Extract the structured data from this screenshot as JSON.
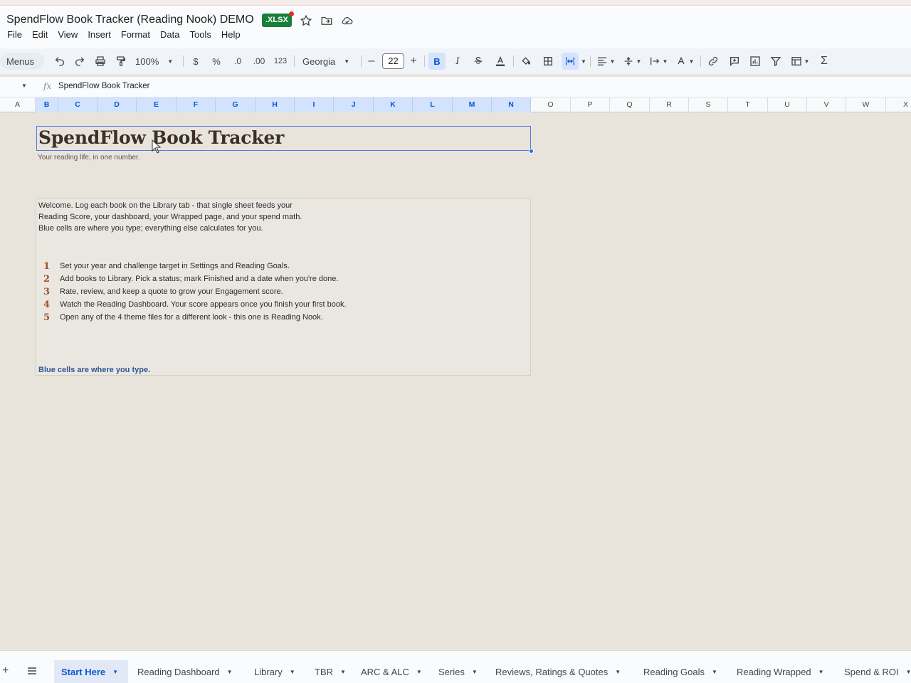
{
  "header": {
    "doc_title": "SpendFlow Book Tracker (Reading Nook) DEMO",
    "badge": ".XLSX",
    "menu": [
      "File",
      "Edit",
      "View",
      "Insert",
      "Format",
      "Data",
      "Tools",
      "Help"
    ]
  },
  "toolbar": {
    "menus_label": "Menus",
    "zoom": "100%",
    "currency": "$",
    "percent": "%",
    "dec_decrease": ".0",
    "dec_increase": ".00",
    "number_format": "123",
    "font": "Georgia",
    "font_size": "22",
    "bold": "B",
    "italic": "I"
  },
  "formula_bar": {
    "fx": "fx",
    "content": "SpendFlow Book Tracker"
  },
  "columns": [
    "A",
    "B",
    "C",
    "D",
    "E",
    "F",
    "G",
    "H",
    "I",
    "J",
    "K",
    "L",
    "M",
    "N",
    "O",
    "P",
    "Q",
    "R",
    "S",
    "T",
    "U",
    "V",
    "W",
    "X"
  ],
  "sheet": {
    "title": "SpendFlow Book Tracker",
    "subtitle": "Your reading life, in one number.",
    "welcome_lines": [
      "Welcome. Log each book on the Library tab - that single sheet feeds your",
      "Reading Score, your dashboard, your Wrapped page, and your spend math.",
      "Blue cells are where you type; everything else calculates for you."
    ],
    "steps": [
      {
        "num": "1",
        "text": "Set your year and challenge target in Settings and Reading Goals."
      },
      {
        "num": "2",
        "text": "Add books to Library. Pick a status; mark Finished and a date when you're done."
      },
      {
        "num": "3",
        "text": "Rate, review, and keep a quote to grow your Engagement score."
      },
      {
        "num": "4",
        "text": "Watch the Reading Dashboard. Your score appears once you finish your first book."
      },
      {
        "num": "5",
        "text": "Open any of the 4 theme files for a different look - this one is Reading Nook."
      }
    ],
    "note": "Blue cells are where you type."
  },
  "tabs": [
    {
      "label": "Start Here",
      "active": true
    },
    {
      "label": "Reading Dashboard"
    },
    {
      "label": "Library"
    },
    {
      "label": "TBR"
    },
    {
      "label": "ARC & ALC"
    },
    {
      "label": "Series"
    },
    {
      "label": "Reviews, Ratings & Quotes"
    },
    {
      "label": "Reading Goals"
    },
    {
      "label": "Reading Wrapped"
    },
    {
      "label": "Spend & ROI"
    }
  ],
  "colors": {
    "selection": "#d3e3fd",
    "accent_blue": "#0b57d0",
    "title_brown": "#3b2f25",
    "step_rust": "#a0522d",
    "note_blue": "#2f5597",
    "sheet_bg": "#e8e4dc"
  }
}
